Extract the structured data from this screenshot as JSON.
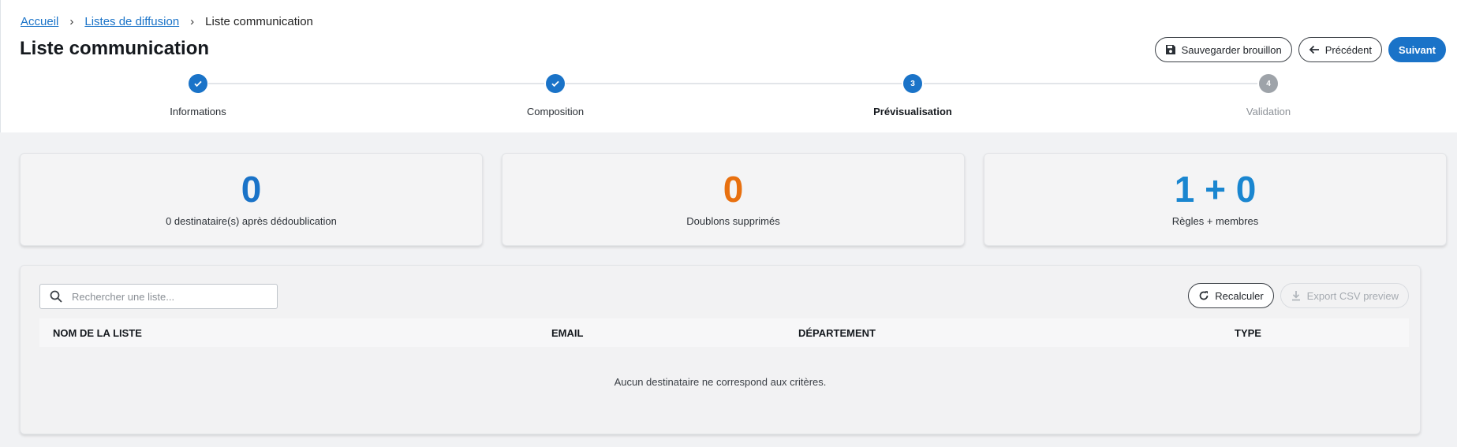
{
  "breadcrumb": [
    {
      "label": "Accueil",
      "link": true
    },
    {
      "label": "Listes de diffusion",
      "link": true
    },
    {
      "label": "Liste communication",
      "link": false
    }
  ],
  "page_title": "Liste communication",
  "actions": {
    "save_draft": {
      "label": "Sauvegarder brouillon",
      "icon": "floppy-disk-icon"
    },
    "previous": {
      "label": "Précédent",
      "icon": "arrow-left-icon"
    },
    "next": {
      "label": "Suivant"
    }
  },
  "stepper": {
    "steps": [
      {
        "label": "Informations",
        "state": "done",
        "marker": ""
      },
      {
        "label": "Composition",
        "state": "done",
        "marker": ""
      },
      {
        "label": "Prévisualisation",
        "state": "active",
        "marker": "3"
      },
      {
        "label": "Validation",
        "state": "pending",
        "marker": "4"
      }
    ]
  },
  "stats": [
    {
      "value": "0",
      "label": "0 destinataire(s) après dédoublication",
      "color": "#1a73c8"
    },
    {
      "value": "0",
      "label": "Doublons supprimés",
      "color": "#e8700f"
    },
    {
      "value": "1 + 0",
      "label": "Règles + membres",
      "color": "#1a86d0"
    }
  ],
  "search": {
    "placeholder": "Rechercher une liste...",
    "value": "",
    "icon": "search-icon"
  },
  "table_actions": {
    "recalculate": {
      "label": "Recalculer",
      "icon": "refresh-icon"
    },
    "export_csv": {
      "label": "Export CSV preview",
      "icon": "download-icon",
      "disabled": true
    }
  },
  "table": {
    "columns": [
      "NOM DE LA LISTE",
      "EMAIL",
      "DÉPARTEMENT",
      "TYPE"
    ],
    "rows": [],
    "empty_message": "Aucun destinataire ne correspond aux critères."
  },
  "colors": {
    "accent": "#1a73c8",
    "warning": "#e8700f",
    "pending": "#9ea3a9"
  }
}
